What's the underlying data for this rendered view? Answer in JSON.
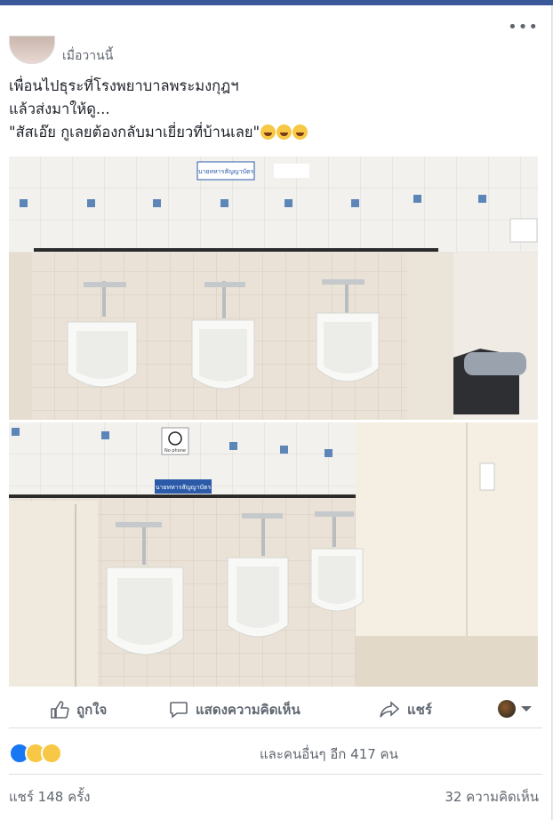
{
  "post": {
    "timestamp": "เมื่อวานนี้",
    "more_label": "•••",
    "lines": [
      "เพื่อนไปธุระที่โรงพยาบาลพระมงกุฎฯ",
      "แล้วส่งมาให้ดู...",
      "\"สัสเอ๊ย กูเลยต้องกลับมาเยี่ยวที่บ้านเลย\""
    ],
    "photo_signs": {
      "top_sign": "นายทหารสัญญาบัตร",
      "bottom_sign": "นายทหารสัญญาบัตร",
      "no_phone_sign": "No phone"
    }
  },
  "actions": {
    "like": "ถูกใจ",
    "comment": "แสดงความคิดเห็น",
    "share": "แชร์"
  },
  "reactions": {
    "others_text": "และคนอื่นๆ อีก 417 คน"
  },
  "stats": {
    "shares": "แชร์ 148 ครั้ง",
    "comments": "32 ความคิดเห็น"
  },
  "colors": {
    "like_blue": "#1877f2",
    "haha_yellow": "#f7c845",
    "text_gray": "#606770",
    "brand_blue": "#3b5998"
  }
}
